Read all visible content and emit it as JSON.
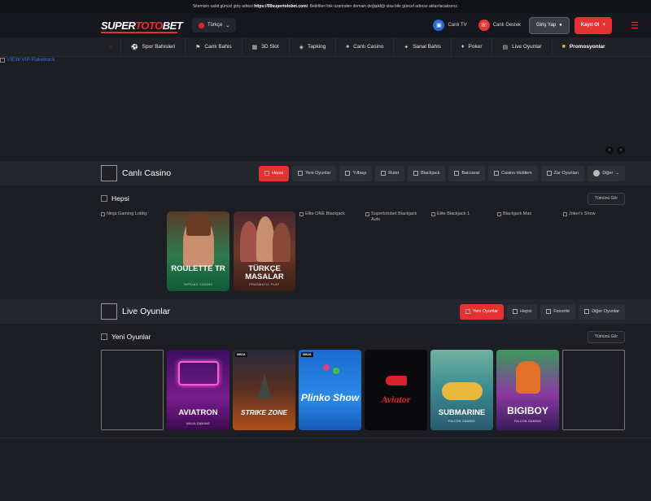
{
  "notice": {
    "prefix": "Sitemizin sabit güncel giriş adresi ",
    "url": "https://99supertotobet.com/",
    "suffix": ". Belirtilen link üzerinden domain değişikliği olsa bile güncel adrese aktarılacaksınız."
  },
  "header": {
    "logo_white": "SUPER",
    "logo_red": "TOTO",
    "logo_white2": "BET",
    "language": "Türkçe",
    "live_tv": "Canlı TV",
    "live_support": "Canlı Destek",
    "login": "Giriş Yap",
    "register": "Kayıt Ol"
  },
  "nav": {
    "items": [
      {
        "label": "Spor Bahisleri",
        "icon": "ball-icon"
      },
      {
        "label": "Canlı Bahis",
        "icon": "live-icon"
      },
      {
        "label": "3D Slot",
        "icon": "slot-icon"
      },
      {
        "label": "Tapking",
        "icon": "tap-icon"
      },
      {
        "label": "Canlı Casino",
        "icon": "cards-icon"
      },
      {
        "label": "Sanal Bahis",
        "icon": "virtual-icon"
      },
      {
        "label": "Poker",
        "icon": "poker-icon"
      },
      {
        "label": "Live Oyunlar",
        "icon": "live-games-icon"
      },
      {
        "label": "Promosyonlar",
        "icon": "gift-icon"
      }
    ]
  },
  "banner": {
    "alt": "VIEW VIP Rakeback"
  },
  "casino": {
    "title": "Canlı Casino",
    "tabs": [
      "Hepsi",
      "Yeni Oyunlar",
      "Yılbaşı",
      "Rulet",
      "Blackjack",
      "Baccarat",
      "Casino Holdem",
      "Zar Oyunları",
      "Diğer"
    ],
    "active_tab": "Hepsi",
    "sub_title": "Hepsi",
    "see_all": "Tümünü Gör",
    "cards": [
      {
        "alt": "Ninja Gaming Lobby"
      },
      {
        "title": "ROULETTE TR",
        "provider": "TAPKING CASINO"
      },
      {
        "title": "TÜRKÇE MASALAR",
        "provider": "PRAGMATIC PLAY"
      },
      {
        "alt": "Elite ONE Blackjack"
      },
      {
        "alt": "Supertotobet Blackjack Auto"
      },
      {
        "alt": "Elite Blackjack 1"
      },
      {
        "alt": "Blackjack Max"
      },
      {
        "alt": "Joker's Show"
      }
    ]
  },
  "live": {
    "title": "Live Oyunlar",
    "tabs": [
      "Yeni Oyunlar",
      "Hepsi",
      "Favorite",
      "Diğer Oyunlar"
    ],
    "active_tab": "Yeni Oyunlar",
    "sub_title": "Yeni Oyunlar",
    "see_all": "Tümünü Gör",
    "games": [
      {
        "title": "",
        "provider": ""
      },
      {
        "title": "AVIATRON",
        "provider": "NINJA GAMING",
        "badge": ""
      },
      {
        "title": "STRIKE ZONE",
        "provider": "",
        "badge": "NINJA"
      },
      {
        "title": "Plinko Show",
        "provider": "",
        "badge": "NINJA"
      },
      {
        "title": "Aviator",
        "provider": "",
        "badge": ""
      },
      {
        "title": "SUBMARINE",
        "provider": "FALCON GAMING",
        "badge": ""
      },
      {
        "title": "BIGIBOY",
        "provider": "FALCON GAMING",
        "badge": ""
      },
      {
        "title": "",
        "provider": ""
      }
    ]
  },
  "colors": {
    "accent": "#e43131",
    "bg": "#1c1e24",
    "bar": "#24262d"
  }
}
